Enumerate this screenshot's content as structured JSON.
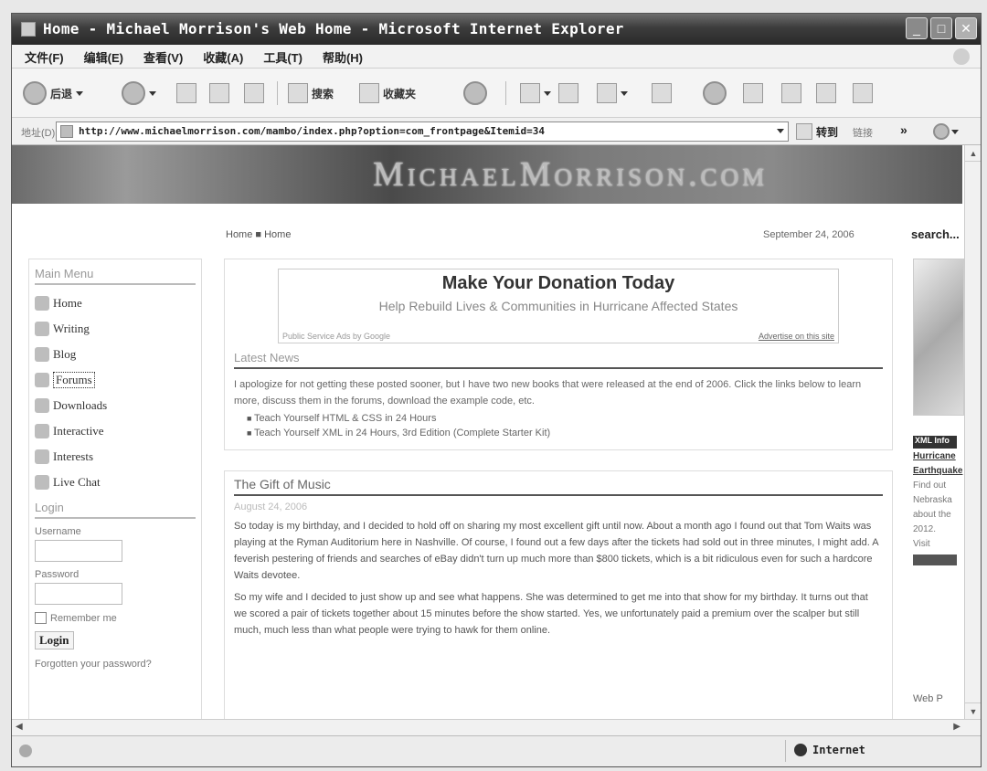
{
  "window": {
    "title": "Home - Michael Morrison's Web Home - Microsoft Internet Explorer",
    "controls": {
      "minimize": "_",
      "maximize": "□",
      "close": "✕"
    }
  },
  "menubar": {
    "items": [
      "文件(F)",
      "编辑(E)",
      "查看(V)",
      "收藏(A)",
      "工具(T)",
      "帮助(H)"
    ]
  },
  "toolbar": {
    "back_label": "后退",
    "search_label": "搜索",
    "favorites_label": "收藏夹"
  },
  "addressbar": {
    "label": "地址(D)",
    "url": "http://www.michaelmorrison.com/mambo/index.php?option=com_frontpage&Itemid=34",
    "go_label": "转到",
    "links_label": "链接",
    "more": "»"
  },
  "banner": {
    "site_name": "MichaelMorrison.com"
  },
  "page": {
    "breadcrumb": "Home ■ Home",
    "date": "September 24, 2006",
    "search_label": "search..."
  },
  "sidebar": {
    "main_menu_heading": "Main Menu",
    "items": [
      {
        "label": "Home",
        "icon": "home-icon"
      },
      {
        "label": "Writing",
        "icon": "writing-icon"
      },
      {
        "label": "Blog",
        "icon": "blog-icon"
      },
      {
        "label": "Forums",
        "icon": "forums-icon"
      },
      {
        "label": "Downloads",
        "icon": "downloads-icon"
      },
      {
        "label": "Interactive",
        "icon": "interactive-icon"
      },
      {
        "label": "Interests",
        "icon": "interests-icon"
      },
      {
        "label": "Live Chat",
        "icon": "chat-icon"
      }
    ],
    "login_heading": "Login",
    "username_label": "Username",
    "password_label": "Password",
    "remember_label": "Remember me",
    "login_button": "Login",
    "forgot": "Forgotten your password?"
  },
  "ad": {
    "headline": "Make Your Donation Today",
    "subline": "Help Rebuild Lives & Communities in Hurricane Affected States",
    "by_line": "Public Service Ads by Google",
    "advertise": "Advertise on this site"
  },
  "latest_news": {
    "heading": "Latest News",
    "text": "I apologize for not getting these posted sooner, but I have two new books that were released at the end of 2006. Click the links below to learn more, discuss them in the forums, download the example code, etc.",
    "bullets": [
      "Teach Yourself HTML & CSS in 24 Hours",
      "Teach Yourself XML in 24 Hours, 3rd Edition (Complete Starter Kit)"
    ]
  },
  "article": {
    "title": "The Gift of Music",
    "date": "August 24, 2006",
    "paragraphs": [
      "So today is my birthday, and I decided to hold off on sharing my most excellent gift until now. About a month ago I found out that Tom Waits was playing at the Ryman Auditorium here in Nashville. Of course, I found out a few days after the tickets had sold out in three minutes, I might add. A feverish pestering of friends and searches of eBay didn't turn up much more than $800 tickets, which is a bit ridiculous even for such a hardcore Waits devotee.",
      "So my wife and I decided to just show up and see what happens. She was determined to get me into that show for my birthday. It turns out that we scored a pair of tickets together about 15 minutes before the show started. Yes, we unfortunately paid a premium over the scalper but still much, much less than what people were trying to hawk for them online."
    ]
  },
  "rightcol": {
    "badge": "XML Info",
    "lines": [
      "Hurricane",
      "Earthquake",
      "Find out",
      "Nebraska",
      "about the",
      "2012.",
      "Visit"
    ],
    "footer": "Web P"
  },
  "statusbar": {
    "zone": "Internet"
  }
}
